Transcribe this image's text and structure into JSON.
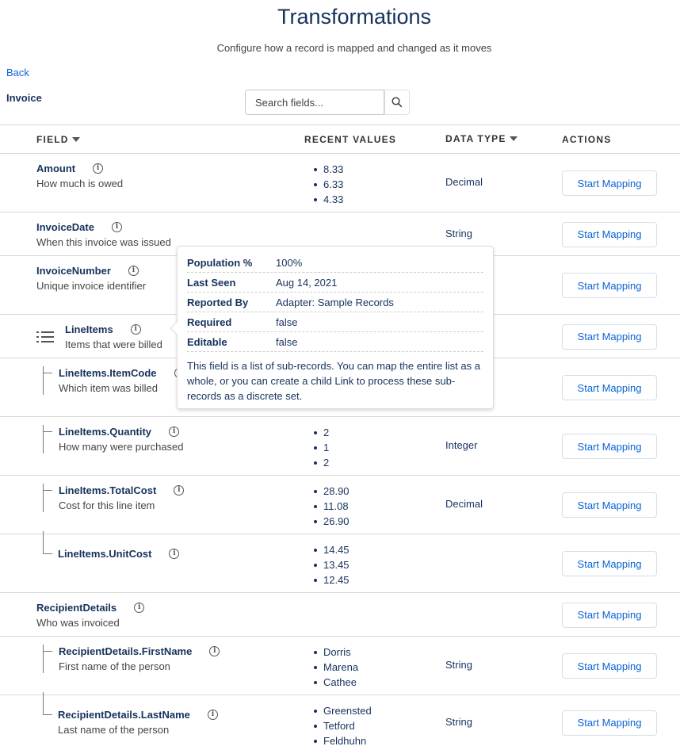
{
  "page": {
    "title": "Transformations",
    "subtitle": "Configure how a record is mapped and changed as it moves",
    "back": "Back",
    "record": "Invoice"
  },
  "search": {
    "placeholder": "Search fields...",
    "icon": "search-icon"
  },
  "columns": {
    "field": "FIELD",
    "recent": "RECENT VALUES",
    "type": "DATA TYPE",
    "actions": "ACTIONS"
  },
  "rows": [
    {
      "name": "Amount",
      "desc": "How much is owed",
      "values": [
        "8.33",
        "6.33",
        "4.33"
      ],
      "type": "Decimal",
      "action": "Start Mapping"
    },
    {
      "name": "InvoiceDate",
      "desc": "When this invoice was issued",
      "values": [],
      "type": "String",
      "action": "Start Mapping"
    },
    {
      "name": "InvoiceNumber",
      "desc": "Unique invoice identifier",
      "values": [],
      "type": "",
      "action": "Start Mapping"
    },
    {
      "name": "LineItems",
      "desc": "Items that were billed",
      "values": [],
      "type": "",
      "action": "Start Mapping"
    },
    {
      "name": "LineItems.ItemCode",
      "desc": "Which item was billed",
      "values": [],
      "type": "",
      "action": "Start Mapping"
    },
    {
      "name": "LineItems.Quantity",
      "desc": "How many were purchased",
      "values": [
        "2",
        "1",
        "2"
      ],
      "type": "Integer",
      "action": "Start Mapping"
    },
    {
      "name": "LineItems.TotalCost",
      "desc": "Cost for this line item",
      "values": [
        "28.90",
        "11.08",
        "26.90"
      ],
      "type": "Decimal",
      "action": "Start Mapping"
    },
    {
      "name": "LineItems.UnitCost",
      "desc": "",
      "values": [
        "14.45",
        "13.45",
        "12.45"
      ],
      "type": "",
      "action": "Start Mapping"
    },
    {
      "name": "RecipientDetails",
      "desc": "Who was invoiced",
      "values": [],
      "type": "",
      "action": "Start Mapping"
    },
    {
      "name": "RecipientDetails.FirstName",
      "desc": "First name of the person",
      "values": [
        "Dorris",
        "Marena",
        "Cathee"
      ],
      "type": "String",
      "action": "Start Mapping"
    },
    {
      "name": "RecipientDetails.LastName",
      "desc": "Last name of the person",
      "values": [
        "Greensted",
        "Tetford",
        "Feldhuhn"
      ],
      "type": "String",
      "action": "Start Mapping"
    }
  ],
  "tooltip": {
    "props": [
      [
        "Population %",
        "100%"
      ],
      [
        "Last Seen",
        "Aug 14, 2021"
      ],
      [
        "Reported By",
        "Adapter: Sample Records"
      ],
      [
        "Required",
        "false"
      ],
      [
        "Editable",
        "false"
      ]
    ],
    "text": "This field is a list of sub-records. You can map the entire list as a whole, or you can create a child Link to process these sub-records as a discrete set."
  }
}
